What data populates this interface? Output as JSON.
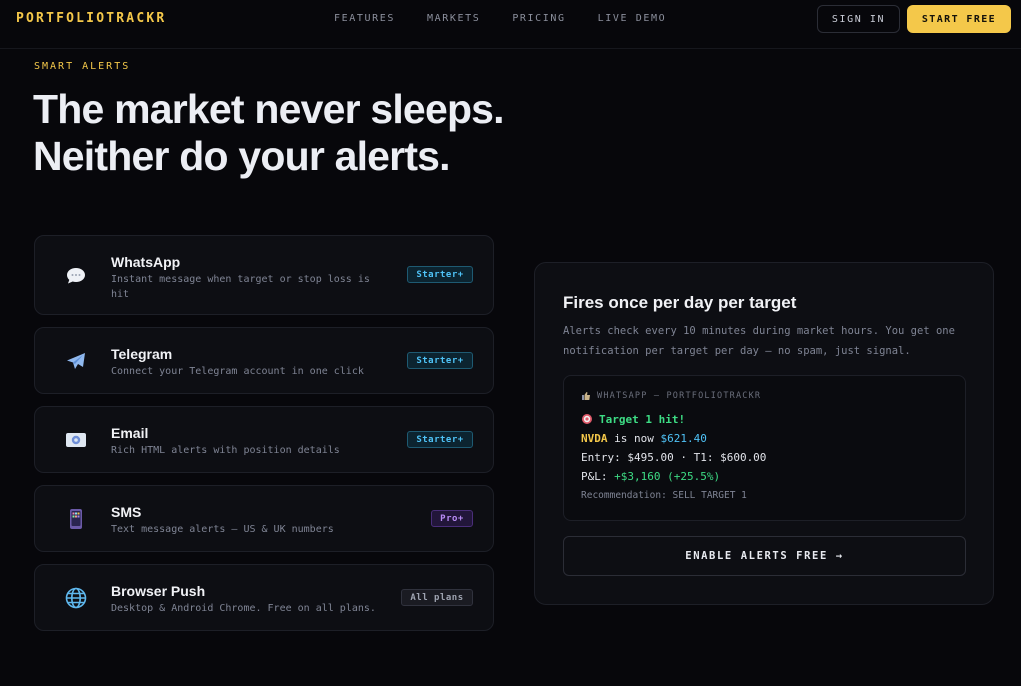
{
  "nav": {
    "logo": "PORTFOLIOTRACKR",
    "links": [
      "FEATURES",
      "MARKETS",
      "PRICING",
      "LIVE DEMO"
    ],
    "sign_in": "SIGN IN",
    "start_free": "START FREE"
  },
  "hero": {
    "eyebrow": "SMART ALERTS",
    "line1": "The market never sleeps.",
    "line2": "Neither do your alerts."
  },
  "channels": [
    {
      "title": "WhatsApp",
      "desc": "Instant message when target or stop loss is hit",
      "badge": "Starter+",
      "icon": "speech-bubble-icon"
    },
    {
      "title": "Telegram",
      "desc": "Connect your Telegram account in one click",
      "badge": "Starter+",
      "icon": "airplane-icon"
    },
    {
      "title": "Email",
      "desc": "Rich HTML alerts with position details",
      "badge": "Starter+",
      "icon": "email-icon"
    },
    {
      "title": "SMS",
      "desc": "Text message alerts — US & UK numbers",
      "badge": "Pro+",
      "icon": "phone-icon"
    },
    {
      "title": "Browser Push",
      "desc": "Desktop & Android Chrome. Free on all plans.",
      "badge": "All plans",
      "icon": "globe-icon"
    }
  ],
  "panel": {
    "title": "Fires once per day per target",
    "desc": "Alerts check every 10 minutes during market hours. You get one notification per target per day — no spam, just signal.",
    "message": {
      "header": "WHATSAPP — PORTFOLIOTRACKR",
      "target_hit": "Target 1 hit!",
      "ticker": "NVDA",
      "is_now": " is now ",
      "price": "$621.40",
      "entry": "Entry: $495.00 · T1: $600.00",
      "pnl_label": "P&L: ",
      "pnl_value": "+$3,160 (+25.5%)",
      "recommendation": "Recommendation: SELL TARGET 1"
    },
    "cta": "ENABLE ALERTS FREE →"
  },
  "colors": {
    "accent": "#f4c84a",
    "background": "#07070b",
    "card": "#0d0e13",
    "starter_badge": "#4fc3f7",
    "pro_badge": "#b98cf5",
    "positive": "#3ddc84"
  }
}
